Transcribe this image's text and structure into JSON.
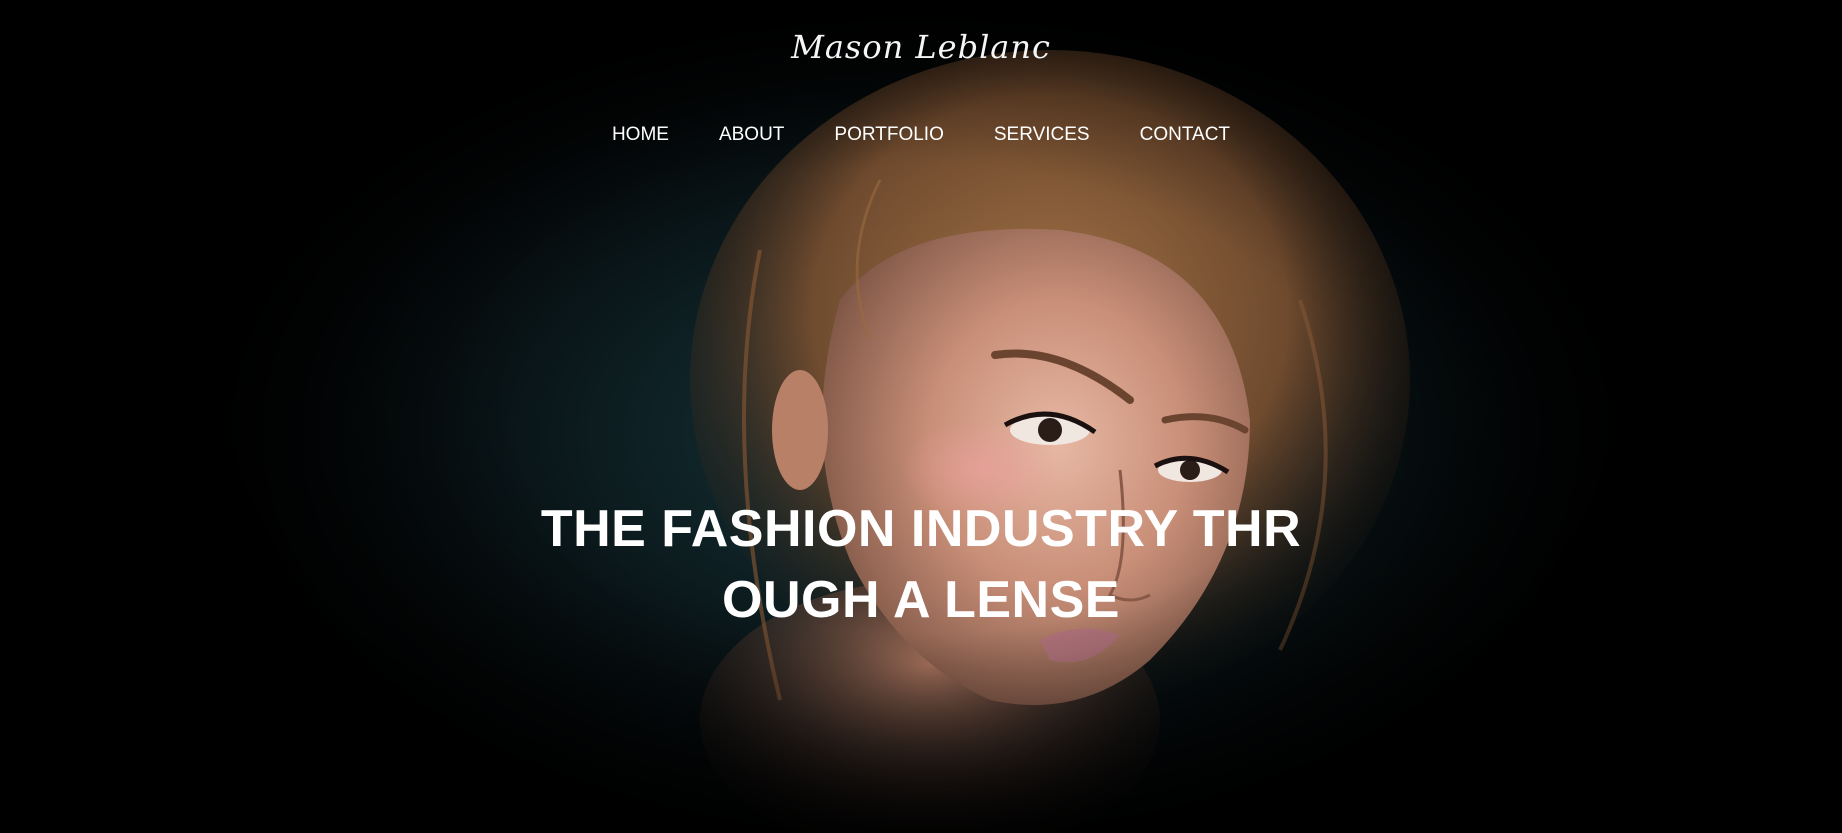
{
  "brand": {
    "name": "Mason Leblanc"
  },
  "nav": {
    "items": [
      {
        "label": "HOME"
      },
      {
        "label": "ABOUT"
      },
      {
        "label": "PORTFOLIO"
      },
      {
        "label": "SERVICES"
      },
      {
        "label": "CONTACT"
      }
    ]
  },
  "hero": {
    "headline": "THE FASHION INDUSTRY THROUGH A LENSE",
    "image_subject": "fashion-model-portrait"
  },
  "colors": {
    "background": "#000000",
    "teal_glow": "#163036",
    "text": "#ffffff"
  }
}
